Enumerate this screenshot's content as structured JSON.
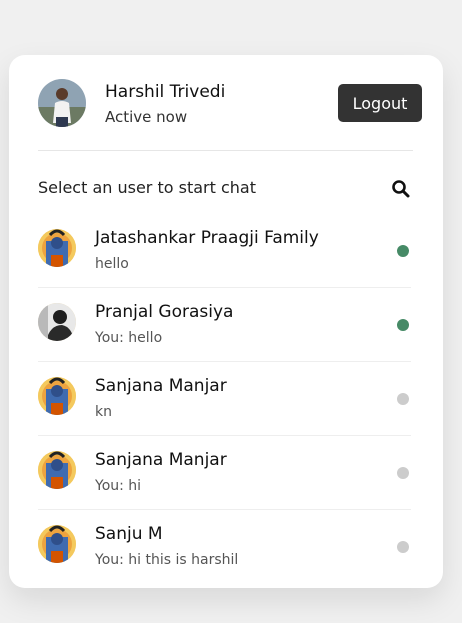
{
  "header": {
    "user_name": "Harshil Trivedi",
    "status": "Active now",
    "logout_label": "Logout"
  },
  "search": {
    "placeholder_text": "Select an user to start chat",
    "icon": "search-icon"
  },
  "colors": {
    "online": "#468a66",
    "offline": "#cccccc",
    "button": "#333333"
  },
  "users": [
    {
      "name": "Jatashankar Praagji Family",
      "last_message": "hello",
      "status": "online",
      "avatar": "shiva-avatar"
    },
    {
      "name": "Pranjal Gorasiya",
      "last_message": "You: hello",
      "status": "online",
      "avatar": "person-photo-avatar"
    },
    {
      "name": "Sanjana Manjar",
      "last_message": "kn",
      "status": "offline",
      "avatar": "shiva-avatar"
    },
    {
      "name": "Sanjana Manjar",
      "last_message": "You: hi",
      "status": "offline",
      "avatar": "shiva-avatar"
    },
    {
      "name": "Sanju M",
      "last_message": "You: hi this is harshil",
      "status": "offline",
      "avatar": "shiva-avatar"
    }
  ]
}
